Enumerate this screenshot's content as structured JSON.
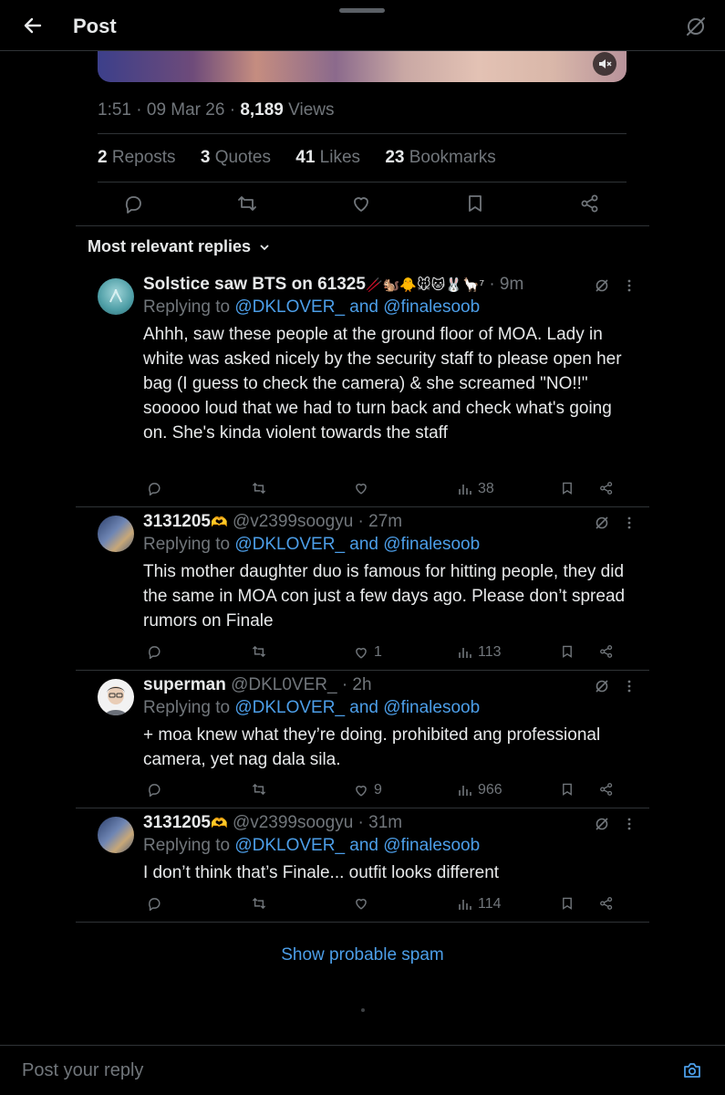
{
  "header": {
    "title": "Post"
  },
  "post": {
    "time": "1:51",
    "date": "09 Mar 26",
    "views_count": "8,189",
    "views_label": "Views",
    "reposts_count": "2",
    "reposts_label": "Reposts",
    "quotes_count": "3",
    "quotes_label": "Quotes",
    "likes_count": "41",
    "likes_label": "Likes",
    "bookmarks_count": "23",
    "bookmarks_label": "Bookmarks"
  },
  "sort_label": "Most relevant replies",
  "replies": [
    {
      "name": "Solstice saw BTS on 61325",
      "emoji": "🥢🐿️🐥🐭🐱🐰🦙⁷",
      "handle": "",
      "time": "· 9m",
      "replying_prefix": "Replying to",
      "replying_mentions": "@DKLOVER_ and @finalesoob",
      "text": "Ahhh, saw these people at the ground floor of MOA. Lady in white was asked nicely by the security staff to please open her bag (I guess to check the camera) & she screamed \"NO!!\" sooooo loud that we had to turn back and check what's going on. She's kinda violent towards the staff",
      "likes": "",
      "views": "38"
    },
    {
      "name": "3131205",
      "emoji": "🫶",
      "handle": "@v2399soogyu",
      "time": "· 27m",
      "replying_prefix": "Replying to",
      "replying_mentions": "@DKLOVER_ and @finalesoob",
      "text": "This mother daughter duo is famous for hitting people, they did the same in MOA con just a few days ago. Please don’t spread rumors on Finale",
      "likes": "1",
      "views": "113"
    },
    {
      "name": "superman",
      "emoji": "",
      "handle": "@DKL0VER_",
      "time": "· 2h",
      "replying_prefix": "Replying to",
      "replying_mentions": "@DKLOVER_ and @finalesoob",
      "text": "+ moa knew what they’re doing. prohibited ang professional camera, yet nag dala sila.",
      "likes": "9",
      "views": "966"
    },
    {
      "name": "3131205",
      "emoji": "🫶",
      "handle": "@v2399soogyu",
      "time": "· 31m",
      "replying_prefix": "Replying to",
      "replying_mentions": "@DKLOVER_ and @finalesoob",
      "text": "I don’t think that’s Finale... outfit looks different",
      "likes": "",
      "views": "114"
    }
  ],
  "spam_label": "Show probable spam",
  "composer_placeholder": "Post your reply",
  "colors": {
    "background": "#000000",
    "text": "#e7e9ea",
    "muted": "#71767b",
    "accent": "#4c9ee8",
    "divider": "#2f3336"
  }
}
